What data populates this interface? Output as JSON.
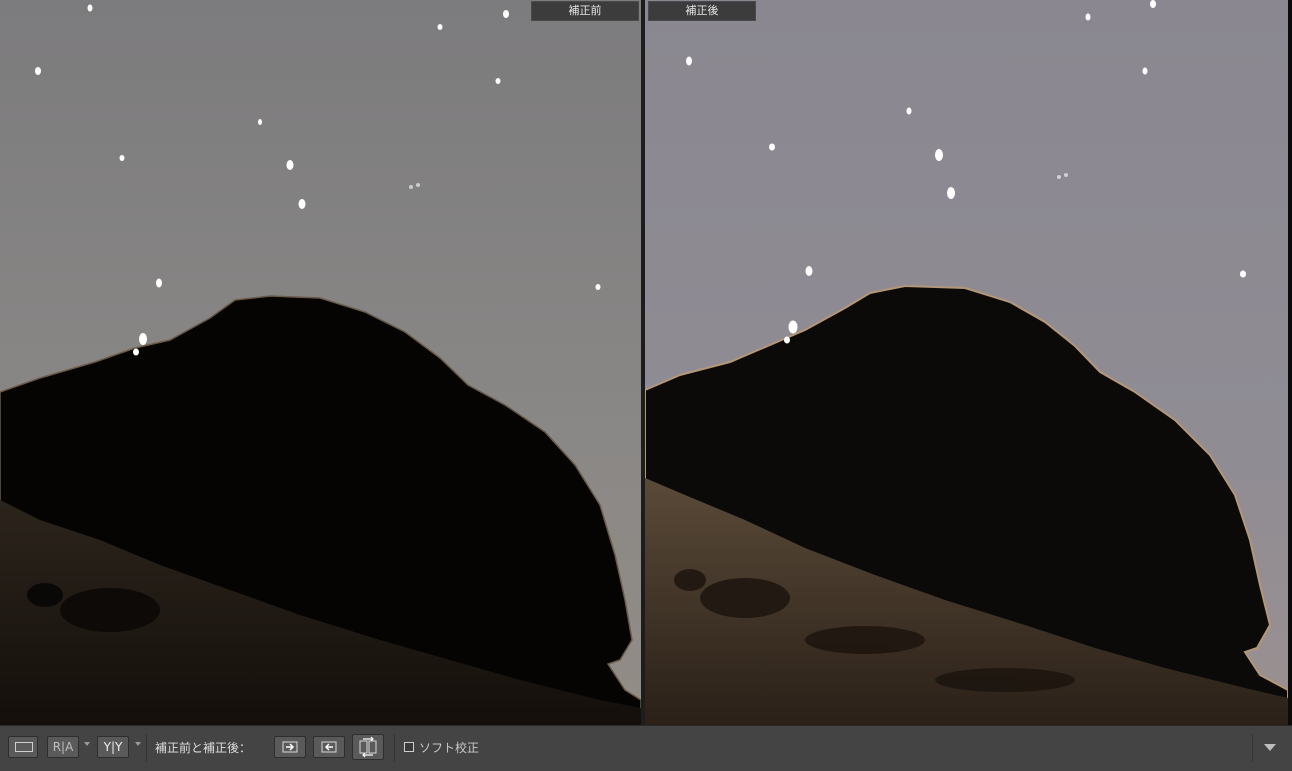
{
  "compare_view": {
    "before_label": "補正前",
    "after_label": "補正後"
  },
  "toolbar": {
    "view_loupe_icon": "loupe-view-icon",
    "before_after_ra_label": "R|A",
    "before_after_yy_label": "Y|Y",
    "compare_label": "補正前と補正後：",
    "copy_before_to_after_icon": "arrow-right-icon",
    "copy_after_to_before_icon": "arrow-left-icon",
    "swap_icon": "swap-icon",
    "soft_proof_label": "ソフト校正",
    "soft_proof_checked": false,
    "toolbar_menu_icon": "chevron-down-icon"
  },
  "colors": {
    "before_sky": "#8a8886",
    "after_sky": "#8e8b94",
    "rock": "#060504",
    "toolbar_bg": "#444444",
    "label_bg": "#3c3c3c"
  }
}
